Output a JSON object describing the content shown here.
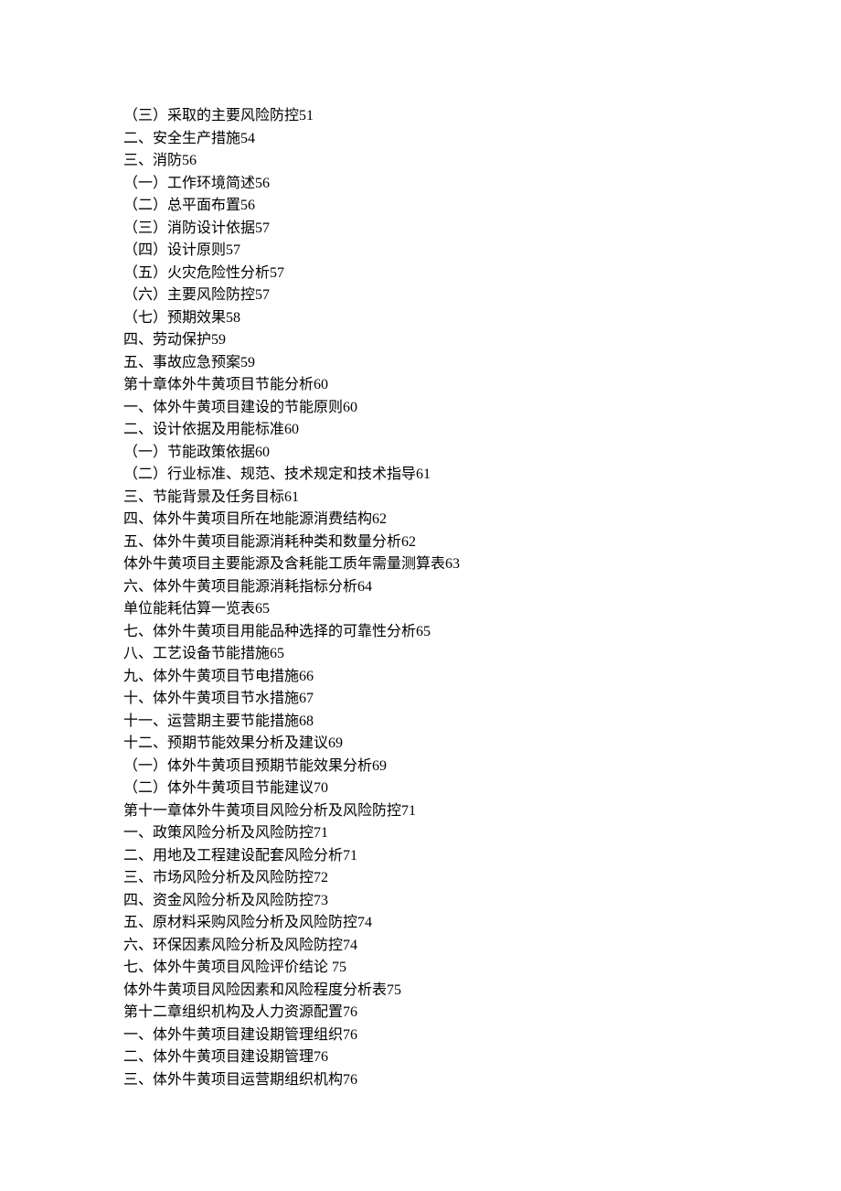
{
  "toc": [
    {
      "text": "（三）采取的主要风险防控",
      "page": "51"
    },
    {
      "text": "二、安全生产措施",
      "page": "54"
    },
    {
      "text": "三、消防",
      "page": "56"
    },
    {
      "text": "（一）工作环境简述",
      "page": "56"
    },
    {
      "text": "（二）总平面布置",
      "page": "56"
    },
    {
      "text": "（三）消防设计依据",
      "page": "57"
    },
    {
      "text": "（四）设计原则",
      "page": "57"
    },
    {
      "text": "（五）火灾危险性分析",
      "page": "57"
    },
    {
      "text": "（六）主要风险防控",
      "page": "57"
    },
    {
      "text": "（七）预期效果",
      "page": "58"
    },
    {
      "text": "四、劳动保护",
      "page": "59"
    },
    {
      "text": "五、事故应急预案",
      "page": "59"
    },
    {
      "text": "第十章体外牛黄项目节能分析",
      "page": "60"
    },
    {
      "text": "一、体外牛黄项目建设的节能原则",
      "page": "60"
    },
    {
      "text": "二、设计依据及用能标准",
      "page": "60"
    },
    {
      "text": "（一）节能政策依据",
      "page": "60"
    },
    {
      "text": "（二）行业标准、规范、技术规定和技术指导",
      "page": "61"
    },
    {
      "text": "三、节能背景及任务目标",
      "page": "61"
    },
    {
      "text": "四、体外牛黄项目所在地能源消费结构",
      "page": "62"
    },
    {
      "text": "五、体外牛黄项目能源消耗种类和数量分析",
      "page": "62"
    },
    {
      "text": "体外牛黄项目主要能源及含耗能工质年需量测算表",
      "page": "63"
    },
    {
      "text": "六、体外牛黄项目能源消耗指标分析",
      "page": "64"
    },
    {
      "text": "单位能耗估算一览表",
      "page": "65"
    },
    {
      "text": "七、体外牛黄项目用能品种选择的可靠性分析",
      "page": "65"
    },
    {
      "text": "八、工艺设备节能措施",
      "page": "65"
    },
    {
      "text": "九、体外牛黄项目节电措施",
      "page": "66"
    },
    {
      "text": "十、体外牛黄项目节水措施",
      "page": "67"
    },
    {
      "text": "十一、运营期主要节能措施",
      "page": "68"
    },
    {
      "text": "十二、预期节能效果分析及建议",
      "page": "69"
    },
    {
      "text": "（一）体外牛黄项目预期节能效果分析",
      "page": "69"
    },
    {
      "text": "（二）体外牛黄项目节能建议",
      "page": "70"
    },
    {
      "text": "第十一章体外牛黄项目风险分析及风险防控",
      "page": "71"
    },
    {
      "text": "一、政策风险分析及风险防控",
      "page": "71"
    },
    {
      "text": "二、用地及工程建设配套风险分析",
      "page": "71"
    },
    {
      "text": "三、市场风险分析及风险防控",
      "page": "72"
    },
    {
      "text": "四、资金风险分析及风险防控",
      "page": "73"
    },
    {
      "text": "五、原材料采购风险分析及风险防控",
      "page": "74"
    },
    {
      "text": "六、环保因素风险分析及风险防控",
      "page": "74"
    },
    {
      "text": "七、体外牛黄项目风险评价结论 ",
      "page": "75"
    },
    {
      "text": "体外牛黄项目风险因素和风险程度分析表",
      "page": "75"
    },
    {
      "text": "第十二章组织机构及人力资源配置",
      "page": "76"
    },
    {
      "text": "一、体外牛黄项目建设期管理组织",
      "page": "76"
    },
    {
      "text": "二、体外牛黄项目建设期管理",
      "page": "76"
    },
    {
      "text": "三、体外牛黄项目运营期组织机构",
      "page": "76"
    }
  ]
}
